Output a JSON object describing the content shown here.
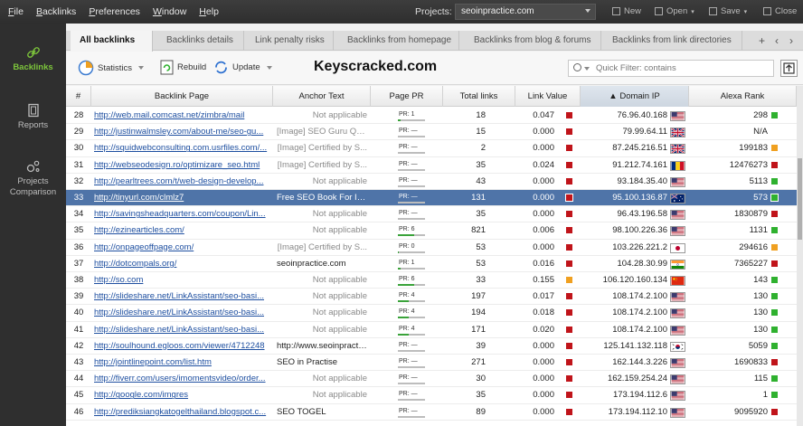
{
  "menu": [
    "File",
    "Backlinks",
    "Preferences",
    "Window",
    "Help"
  ],
  "projects": {
    "label": "Projects:",
    "value": "seoinpractice.com"
  },
  "top_buttons": {
    "new": "New",
    "open": "Open",
    "save": "Save",
    "close": "Close"
  },
  "sidebar": [
    {
      "label": "Backlinks",
      "icon": "link-icon"
    },
    {
      "label": "Reports",
      "icon": "report-icon"
    },
    {
      "label": "Projects Comparison",
      "label1": "Projects",
      "label2": "Comparison",
      "icon": "compare-icon"
    }
  ],
  "tabs": [
    "All backlinks",
    "Backlinks details",
    "Link penalty risks",
    "Backlinks from homepage",
    "Backlinks from blog & forums",
    "Backlinks from link directories"
  ],
  "toolbar": {
    "statistics": "Statistics",
    "rebuild": "Rebuild",
    "update": "Update",
    "watermark": "Keyscracked.com",
    "filter_placeholder": "Quick Filter: contains"
  },
  "columns": [
    "#",
    "Backlink Page",
    "Anchor Text",
    "Page PR",
    "Total links",
    "Link Value",
    "Domain IP",
    "Alexa Rank"
  ],
  "sorted_column_prefix": "▲ ",
  "colors": {
    "green": "#2fb12f",
    "red": "#c0141a",
    "orange": "#f0a020",
    "selected": "#4f74a8",
    "accent": "#7cc43b"
  },
  "rows": [
    {
      "num": "28",
      "url": "http://web.mail.comcast.net/zimbra/mail",
      "anchor": "Not applicable",
      "anchor_na": true,
      "pr": "PR: 1",
      "pr_fill": 0.1,
      "links": "18",
      "lv": "0.047",
      "lv_color": "red",
      "ip": "76.96.40.168",
      "flag": "us",
      "alexa": "298",
      "alexa_color": "green"
    },
    {
      "num": "29",
      "url": "http://justinwalmsley.com/about-me/seo-gu...",
      "anchor": "[Image] SEO Guru Qu...",
      "anchor_na": true,
      "pr": "PR: —",
      "pr_fill": 0,
      "links": "15",
      "lv": "0.000",
      "lv_color": "red",
      "ip": "79.99.64.11",
      "flag": "gb",
      "alexa": "N/A",
      "alexa_color": ""
    },
    {
      "num": "30",
      "url": "http://squidwebconsulting.com.usrfiles.com/...",
      "anchor": "[Image] Certified by S...",
      "anchor_na": true,
      "pr": "PR: —",
      "pr_fill": 0,
      "links": "2",
      "lv": "0.000",
      "lv_color": "red",
      "ip": "87.245.216.51",
      "flag": "gb",
      "alexa": "199183",
      "alexa_color": "orange"
    },
    {
      "num": "31",
      "url": "http://webseodesign.ro/optimizare_seo.html",
      "anchor": "[Image] Certified by S...",
      "anchor_na": true,
      "pr": "PR: —",
      "pr_fill": 0,
      "links": "35",
      "lv": "0.024",
      "lv_color": "red",
      "ip": "91.212.74.161",
      "flag": "ro",
      "alexa": "12476273",
      "alexa_color": "red"
    },
    {
      "num": "32",
      "url": "http://pearltrees.com/t/web-design-develop...",
      "anchor": "Not applicable",
      "anchor_na": true,
      "pr": "PR: —",
      "pr_fill": 0,
      "links": "43",
      "lv": "0.000",
      "lv_color": "red",
      "ip": "93.184.35.40",
      "flag": "us",
      "alexa": "5113",
      "alexa_color": "green"
    },
    {
      "num": "33",
      "url": "http://tinyurl.com/clmlz7",
      "anchor": "Free SEO Book For In...",
      "anchor_na": false,
      "pr": "PR: —",
      "pr_fill": 0,
      "links": "131",
      "lv": "0.000",
      "lv_color": "red",
      "ip": "95.100.136.87",
      "flag": "au",
      "alexa": "573",
      "alexa_color": "green",
      "selected": true
    },
    {
      "num": "34",
      "url": "http://savingsheadquarters.com/coupon/Lin...",
      "anchor": "Not applicable",
      "anchor_na": true,
      "pr": "PR: —",
      "pr_fill": 0,
      "links": "35",
      "lv": "0.000",
      "lv_color": "red",
      "ip": "96.43.196.58",
      "flag": "us",
      "alexa": "1830879",
      "alexa_color": "red"
    },
    {
      "num": "35",
      "url": "http://ezinearticles.com/",
      "anchor": "Not applicable",
      "anchor_na": true,
      "pr": "PR: 6",
      "pr_fill": 0.6,
      "links": "821",
      "lv": "0.006",
      "lv_color": "red",
      "ip": "98.100.226.36",
      "flag": "us",
      "alexa": "1131",
      "alexa_color": "green"
    },
    {
      "num": "36",
      "url": "http://onpageoffpage.com/",
      "anchor": "[Image] Certified by S...",
      "anchor_na": true,
      "pr": "PR: 0",
      "pr_fill": 0.02,
      "links": "53",
      "lv": "0.000",
      "lv_color": "red",
      "ip": "103.226.221.2",
      "flag": "jp",
      "alexa": "294616",
      "alexa_color": "orange"
    },
    {
      "num": "37",
      "url": "http://dotcompals.org/",
      "anchor": "seoinpractice.com",
      "anchor_na": false,
      "pr": "PR: 1",
      "pr_fill": 0.1,
      "links": "53",
      "lv": "0.016",
      "lv_color": "red",
      "ip": "104.28.30.99",
      "flag": "in",
      "alexa": "7365227",
      "alexa_color": "red"
    },
    {
      "num": "38",
      "url": "http://so.com",
      "anchor": "Not applicable",
      "anchor_na": true,
      "pr": "PR: 6",
      "pr_fill": 0.6,
      "links": "33",
      "lv": "0.155",
      "lv_color": "orange",
      "ip": "106.120.160.134",
      "flag": "cn",
      "alexa": "143",
      "alexa_color": "green"
    },
    {
      "num": "39",
      "url": "http://slideshare.net/LinkAssistant/seo-basi...",
      "anchor": "Not applicable",
      "anchor_na": true,
      "pr": "PR: 4",
      "pr_fill": 0.4,
      "links": "197",
      "lv": "0.017",
      "lv_color": "red",
      "ip": "108.174.2.100",
      "flag": "us",
      "alexa": "130",
      "alexa_color": "green"
    },
    {
      "num": "40",
      "url": "http://slideshare.net/LinkAssistant/seo-basi...",
      "anchor": "Not applicable",
      "anchor_na": true,
      "pr": "PR: 4",
      "pr_fill": 0.4,
      "links": "194",
      "lv": "0.018",
      "lv_color": "red",
      "ip": "108.174.2.100",
      "flag": "us",
      "alexa": "130",
      "alexa_color": "green"
    },
    {
      "num": "41",
      "url": "http://slideshare.net/LinkAssistant/seo-basi...",
      "anchor": "Not applicable",
      "anchor_na": true,
      "pr": "PR: 4",
      "pr_fill": 0.4,
      "links": "171",
      "lv": "0.020",
      "lv_color": "red",
      "ip": "108.174.2.100",
      "flag": "us",
      "alexa": "130",
      "alexa_color": "green"
    },
    {
      "num": "42",
      "url": "http://soulhound.egloos.com/viewer/4712248",
      "anchor": "http://www.seoinpracti...",
      "anchor_na": false,
      "pr": "PR: —",
      "pr_fill": 0,
      "links": "39",
      "lv": "0.000",
      "lv_color": "red",
      "ip": "125.141.132.118",
      "flag": "kr",
      "alexa": "5059",
      "alexa_color": "green"
    },
    {
      "num": "43",
      "url": "http://jointlinepoint.com/list.htm",
      "anchor": "SEO in Practise",
      "anchor_na": false,
      "pr": "PR: —",
      "pr_fill": 0,
      "links": "271",
      "lv": "0.000",
      "lv_color": "red",
      "ip": "162.144.3.226",
      "flag": "us",
      "alexa": "1690833",
      "alexa_color": "red"
    },
    {
      "num": "44",
      "url": "http://fiverr.com/users/imomentsvideo/order...",
      "anchor": "Not applicable",
      "anchor_na": true,
      "pr": "PR: —",
      "pr_fill": 0,
      "links": "30",
      "lv": "0.000",
      "lv_color": "red",
      "ip": "162.159.254.24",
      "flag": "us",
      "alexa": "115",
      "alexa_color": "green"
    },
    {
      "num": "45",
      "url": "http://google.com/imgres",
      "anchor": "Not applicable",
      "anchor_na": true,
      "pr": "PR: —",
      "pr_fill": 0,
      "links": "35",
      "lv": "0.000",
      "lv_color": "red",
      "ip": "173.194.112.6",
      "flag": "us",
      "alexa": "1",
      "alexa_color": "green"
    },
    {
      "num": "46",
      "url": "http://prediksiangkatogelthailand.blogspot.c...",
      "anchor": "SEO TOGEL",
      "anchor_na": false,
      "pr": "PR: —",
      "pr_fill": 0,
      "links": "89",
      "lv": "0.000",
      "lv_color": "red",
      "ip": "173.194.112.10",
      "flag": "us",
      "alexa": "9095920",
      "alexa_color": "red"
    }
  ]
}
